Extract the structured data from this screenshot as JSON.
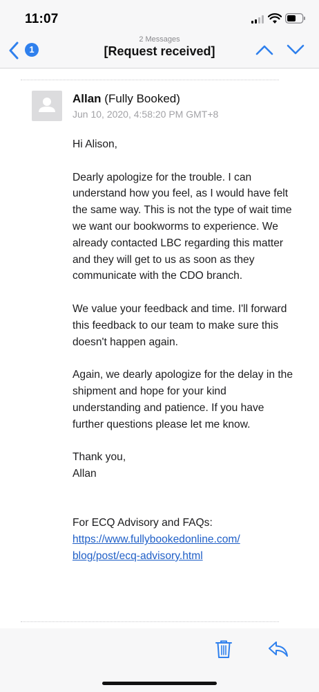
{
  "status": {
    "time": "11:07"
  },
  "nav": {
    "unread_count": "1",
    "message_count": "2 Messages",
    "subject": "[Request received]"
  },
  "message": {
    "sender_name": "Allan",
    "sender_org": "(Fully Booked)",
    "date": "Jun 10, 2020, 4:58:20 PM GMT+8",
    "greeting": "Hi Alison,",
    "paragraph_1": "Dearly apologize for the trouble. I can understand how you feel, as I would have felt the same way. This is not the type of wait time we want our bookworms to experience. We already contacted LBC regarding this matter and they will get to us as soon as they communicate with the CDO branch.",
    "paragraph_2": "We value your feedback and time. I'll forward this feedback to our team to make sure this doesn't happen again.",
    "paragraph_3": "Again, we dearly apologize for the delay in the shipment and hope for your kind understanding and patience. If you have further questions please let me know.",
    "closing": "Thank you,",
    "signature": "Allan",
    "advisory_label": "For ECQ Advisory and FAQs:",
    "link_line_1": "https://www.fullybookedonline.com/",
    "link_line_2": "blog/post/ecq-advisory.html"
  },
  "icons": {
    "back": "chevron-left-icon",
    "up": "chevron-up-icon",
    "down": "chevron-down-icon",
    "trash": "trash-icon",
    "reply": "reply-icon"
  },
  "colors": {
    "accent": "#2f80ed",
    "link": "#1f5fc7"
  }
}
